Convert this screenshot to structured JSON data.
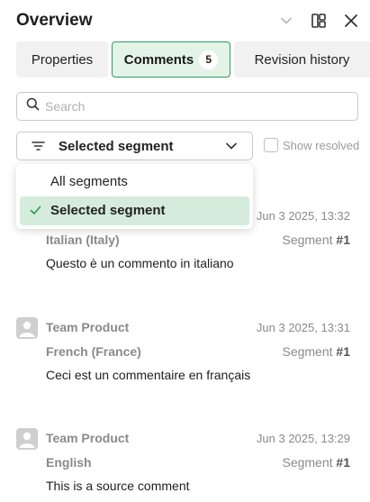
{
  "header": {
    "title": "Overview"
  },
  "tabs": [
    {
      "label": "Properties",
      "active": false
    },
    {
      "label": "Comments",
      "badge": "5",
      "active": true
    },
    {
      "label": "Revision history",
      "active": false
    }
  ],
  "search": {
    "placeholder": "Search",
    "value": ""
  },
  "filter": {
    "selected_label": "Selected segment",
    "options": [
      {
        "label": "All segments",
        "selected": false
      },
      {
        "label": "Selected segment",
        "selected": true
      }
    ]
  },
  "show_resolved": {
    "label": "Show resolved",
    "checked": false
  },
  "comments": [
    {
      "author": "",
      "timestamp": "Jun 3 2025, 13:32",
      "language": "Italian (Italy)",
      "segment_prefix": "Segment ",
      "segment_number": "#1",
      "text": "Questo è un commento in italiano"
    },
    {
      "author": "Team Product",
      "timestamp": "Jun 3 2025, 13:31",
      "language": "French (France)",
      "segment_prefix": "Segment ",
      "segment_number": "#1",
      "text": "Ceci est un commentaire en français"
    },
    {
      "author": "Team Product",
      "timestamp": "Jun 3 2025, 13:29",
      "language": "English",
      "segment_prefix": "Segment ",
      "segment_number": "#1",
      "text": "This is a source comment"
    }
  ],
  "colors": {
    "accent": "#2e9a5c",
    "active_tab_bg": "#e3f3e8",
    "selected_option_bg": "#d5ebdc",
    "muted_text": "#8a8a8a"
  },
  "icons": [
    "chevron-down-icon",
    "layout-panel-icon",
    "close-icon",
    "search-icon",
    "filter-lines-icon",
    "checkmark-icon",
    "user-avatar-icon"
  ]
}
